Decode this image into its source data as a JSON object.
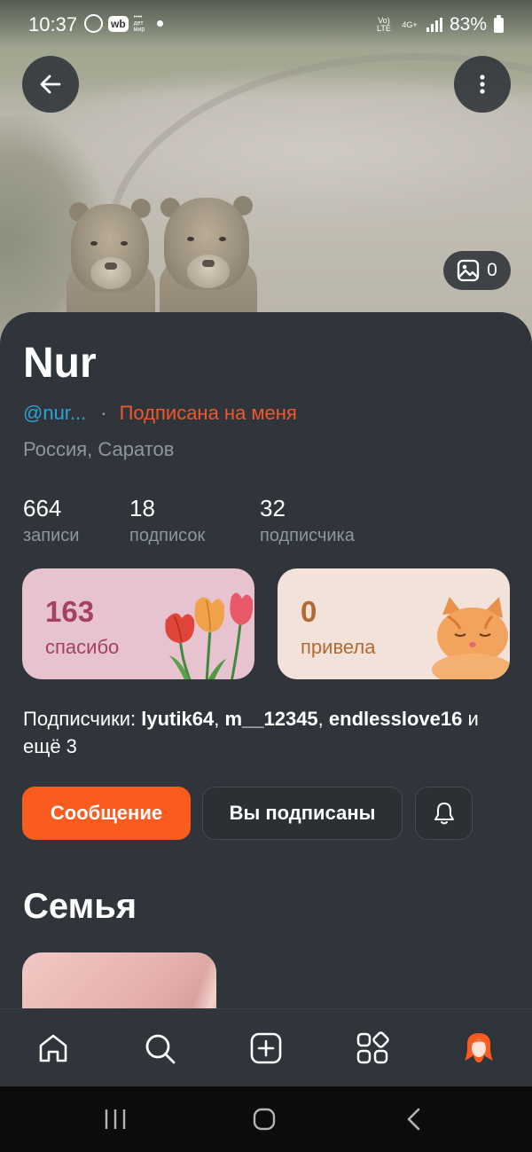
{
  "status_bar": {
    "time": "10:37",
    "app_badge_wb": "wb",
    "app_badge_dm": "•••• дет мир",
    "network_volte": "Vo) LTE",
    "network_4g": "4G+",
    "battery": "83%"
  },
  "cover": {
    "photo_count": "0"
  },
  "profile": {
    "name": "Nur",
    "handle": "@nur...",
    "separator": "·",
    "follows_you": "Подписана на меня",
    "location": "Россия, Саратов"
  },
  "stats": [
    {
      "value": "664",
      "label": "записи"
    },
    {
      "value": "18",
      "label": "подписок"
    },
    {
      "value": "32",
      "label": "подписчика"
    }
  ],
  "tiles": {
    "thanks": {
      "value": "163",
      "label": "спасибо"
    },
    "hello": {
      "value": "0",
      "label": "привела"
    }
  },
  "followers_line": {
    "prefix": "Подписчики:",
    "user1": "lyutik64",
    "comma1": ",",
    "user2": "m__12345",
    "comma2": ",",
    "user3": "endlesslove16",
    "suffix": "и ещё 3"
  },
  "actions": {
    "message": "Сообщение",
    "subscribed": "Вы подписаны"
  },
  "section": {
    "title": "Семья"
  },
  "colors": {
    "accent": "#fa5b1f",
    "handle": "#2aa4d8",
    "card_bg": "#30353b"
  },
  "icons": {
    "back": "arrow-left-icon",
    "more": "more-vertical-icon",
    "photos": "image-icon",
    "bell": "bell-icon",
    "nav": [
      "home-icon",
      "search-icon",
      "add-square-icon",
      "apps-icon",
      "profile-avatar-icon"
    ],
    "system": [
      "recents-icon",
      "home-circle-icon",
      "back-chevron-icon"
    ]
  }
}
